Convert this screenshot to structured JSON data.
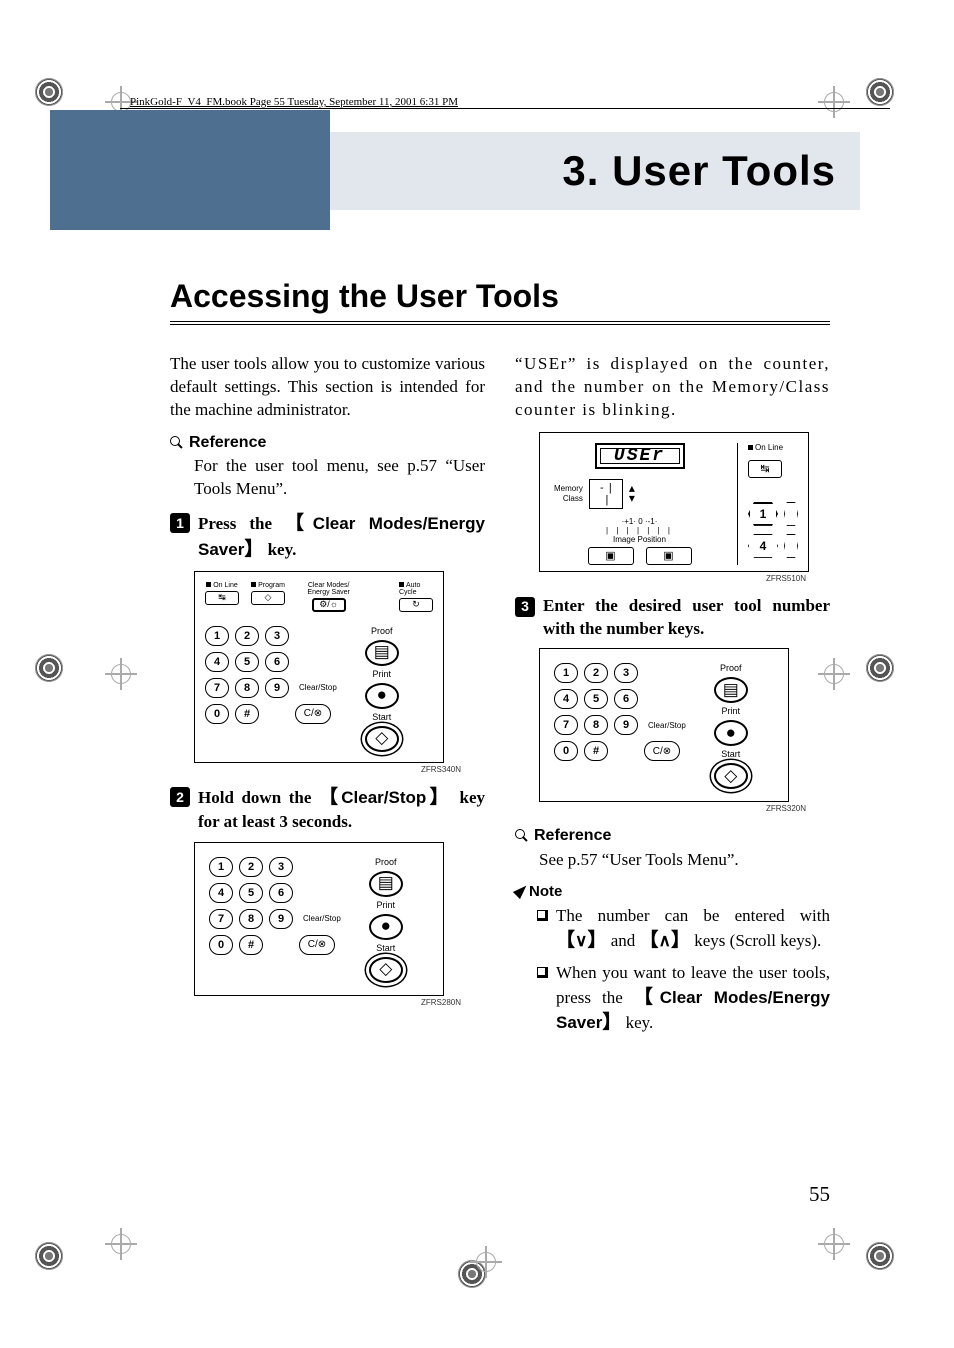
{
  "header_stamp": "PinkGold-F_V4_FM.book  Page 55  Tuesday, September 11, 2001  6:31 PM",
  "chapter": {
    "number": "3.",
    "title": "User Tools"
  },
  "section_heading": "Accessing the User Tools",
  "intro": "The user tools allow you to customize various default settings. This section is intended for the machine administrator.",
  "reference1": {
    "label": "Reference",
    "body": "For the user tool menu, see p.57 “User Tools Menu”."
  },
  "steps": {
    "s1": {
      "pre": "Press the ",
      "key": "Clear Modes/Energy Saver",
      "post": " key."
    },
    "s2": {
      "pre": "Hold down the ",
      "key": "Clear/Stop",
      "post": " key for at least 3 seconds."
    },
    "s3": {
      "pre": "Enter the desired user tool number with the number keys."
    }
  },
  "right_intro": "“USEr” is displayed on the counter, and the number on the Memory/Class counter is blinking.",
  "reference2": {
    "label": "Reference",
    "body": "See p.57 “User Tools Menu”."
  },
  "note": {
    "label": "Note",
    "items": [
      {
        "pre": "The number can be entered with ",
        "k1": "∨",
        "mid": " and ",
        "k2": "∧",
        "post": " keys (Scroll keys)."
      },
      {
        "pre": "When you want to leave the user tools, press the ",
        "key": "Clear Modes/Energy Saver",
        "post": " key."
      }
    ]
  },
  "figcodes": {
    "a": "ZFRS340N",
    "b": "ZFRS280N",
    "c": "ZFRS510N",
    "d": "ZFRS320N"
  },
  "keypad": {
    "keys": [
      [
        "1",
        "2",
        "3"
      ],
      [
        "4",
        "5",
        "6"
      ],
      [
        "7",
        "8",
        "9"
      ],
      [
        "0",
        "#"
      ]
    ],
    "clearstop": "Clear/Stop",
    "cbtn": "C/⊗",
    "proof": "Proof",
    "print": "Print",
    "start": "Start",
    "diamond": "◇",
    "dot": "●",
    "sheet": "▤"
  },
  "toppanel": {
    "online": "On Line",
    "program": "Program",
    "cmes": "Clear Modes/\nEnergy Saver",
    "auto": "Auto Cycle",
    "tab": "↹",
    "diamond": "◇",
    "gear": "⚙/☼",
    "loop": "↻"
  },
  "disp": {
    "lcd": "USEr",
    "online": "On Line",
    "tab": "↹",
    "memory": "Memory",
    "class": "Class",
    "imgpos": "Image Position",
    "ticks": "·+1·  0  ·-1·",
    "bars": "| | |  | | | |",
    "one": "1",
    "four": "4",
    "icon": "▣"
  },
  "page_number": "55"
}
